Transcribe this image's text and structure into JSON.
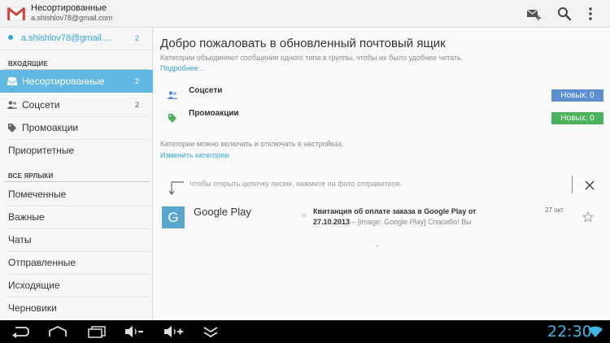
{
  "header": {
    "title": "Несортированные",
    "account": "a.shishlov78@gmail.com",
    "icons": [
      "gmail-logo-icon",
      "compose-icon",
      "search-icon",
      "overflow-menu-icon"
    ]
  },
  "sidebar": {
    "account": {
      "email": "a.shishlov78@gmail....",
      "count": "2"
    },
    "inbox_section": "ВХОДЯЩИЕ",
    "labels_section": "ВСЕ ЯРЛЫКИ",
    "inbox_items": [
      {
        "label": "Несортированные",
        "count": "2",
        "icon": "inbox-icon",
        "active": true
      },
      {
        "label": "Соцсети",
        "count": "2",
        "icon": "people-icon",
        "active": false
      },
      {
        "label": "Промоакции",
        "count": "",
        "icon": "tag-icon",
        "active": false
      },
      {
        "label": "Приоритетные",
        "count": "",
        "icon": "",
        "active": false
      }
    ],
    "label_items": [
      {
        "label": "Помеченные"
      },
      {
        "label": "Важные"
      },
      {
        "label": "Чаты"
      },
      {
        "label": "Отправленные"
      },
      {
        "label": "Исходящие"
      },
      {
        "label": "Черновики"
      }
    ]
  },
  "main": {
    "welcome_title": "Добро пожаловать в обновленный почтовый ящик",
    "welcome_desc": "Категории объединяют сообщения одного типа в группы, чтобы их было удобнее читать.",
    "more_link": "Подробнее...",
    "categories": [
      {
        "name": "Соцсети",
        "badge": "Новых: 0",
        "icon": "people-icon",
        "color": "#5b8fd0"
      },
      {
        "name": "Промоакции",
        "badge": "Новых: 0",
        "icon": "tag-icon",
        "color": "#4ab25a"
      }
    ],
    "switch_desc": "Категории можно включать и отключать в настройках.",
    "change_link": "Изменить категории",
    "tip": "Чтобы открыть цепочку писем, нажмите на фото отправителя.",
    "message": {
      "avatar_letter": "G",
      "sender": "Google Play",
      "mark": "»",
      "subject": "Квитанция об оплате заказа в Google Play от 27.10.2013",
      "snippet": " – [image: Google Play] Спасибо! Вы",
      "date": "27 окт"
    }
  },
  "system": {
    "time": "22:30"
  },
  "colors": {
    "accent": "#33a4d8",
    "active_nav": "#60b8e3",
    "social_badge": "#5b8fd0",
    "promo_badge": "#4ab25a",
    "time": "#3fb5e5"
  }
}
